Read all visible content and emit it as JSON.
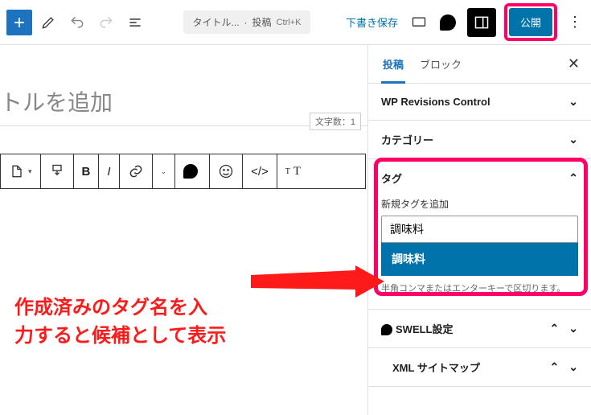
{
  "topbar": {
    "doc_summary_prefix": "タイトル...",
    "doc_summary_type": "投稿",
    "doc_summary_kbd": "Ctrl+K",
    "draft_save": "下書き保存",
    "publish": "公開"
  },
  "editor": {
    "title_placeholder": "トルを追加",
    "char_count_label": "文字数：1",
    "annotation_line1": "作成済みのタグ名を入",
    "annotation_line2": "力すると候補として表示",
    "toolbar": {
      "bold": "B",
      "italic": "I",
      "code": "</>"
    }
  },
  "sidebar": {
    "tabs": {
      "post": "投稿",
      "block": "ブロック"
    },
    "panels": {
      "revisions": "WP Revisions Control",
      "category": "カテゴリー",
      "tag": {
        "title": "タグ",
        "field_label": "新規タグを追加",
        "input_value": "調味料",
        "suggestion": "調味料",
        "hint": "半角コンマまたはエンターキーで区切ります。"
      },
      "swell": "SWELL設定",
      "xml_sitemap": "XML サイトマップ"
    }
  },
  "colors": {
    "accent": "#ff0066",
    "primary": "#0073aa",
    "annotation_red": "#ff1a1a"
  }
}
